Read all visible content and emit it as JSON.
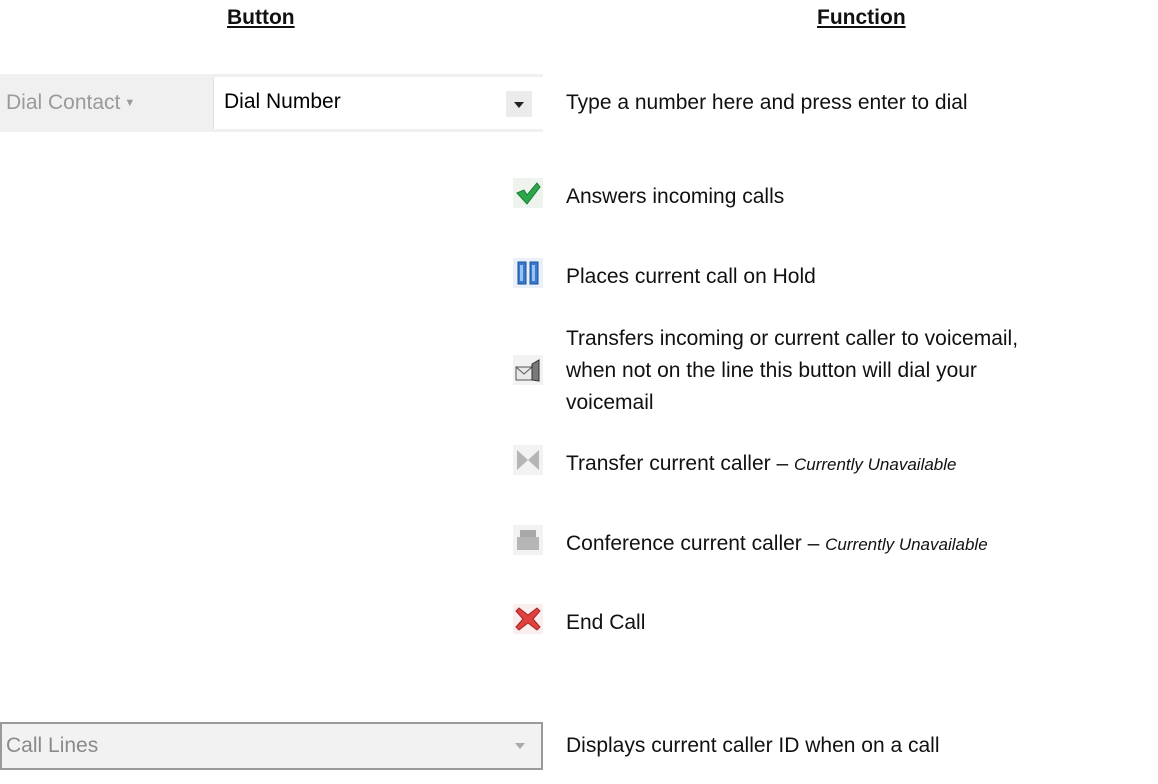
{
  "headers": {
    "button": "Button",
    "function": "Function"
  },
  "dial": {
    "contact_label": "Dial Contact",
    "number_value": "Dial Number",
    "description": "Type a number  here and press enter to dial"
  },
  "rows": [
    {
      "icon": "check-icon",
      "text": "Answers incoming calls"
    },
    {
      "icon": "hold-icon",
      "text": "Places current call on Hold"
    },
    {
      "icon": "voicemail-icon",
      "lines": [
        "Transfers incoming or current caller to voicemail,",
        "when not on the line this button will dial your",
        "voicemail"
      ]
    },
    {
      "icon": "transfer-icon",
      "text": "Transfer current caller – ",
      "note": "Currently Unavailable"
    },
    {
      "icon": "conference-icon",
      "text": "Conference current caller – ",
      "note": "Currently Unavailable"
    },
    {
      "icon": "end-call-icon",
      "text": "End Call"
    }
  ],
  "call_lines": {
    "label": "Call Lines",
    "description": "Displays current caller ID when on a call"
  },
  "colors": {
    "check": "#2aa84a",
    "hold": "#2f6fc7",
    "end": "#e04040",
    "disabled": "#b5b5b5"
  }
}
